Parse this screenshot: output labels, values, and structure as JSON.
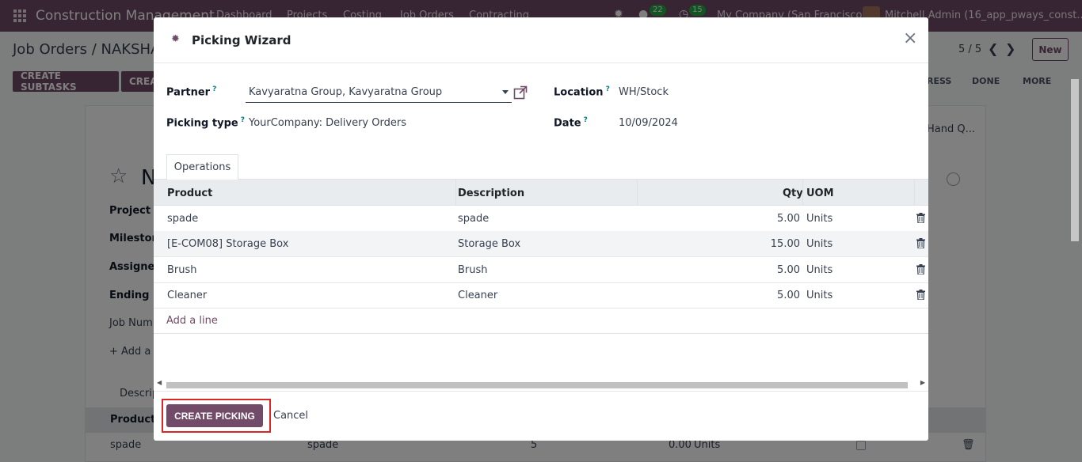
{
  "topnav": {
    "brand": "Construction Management",
    "menu": [
      "Dashboard",
      "Projects",
      "Costing",
      "Job Orders",
      "Contracting"
    ],
    "messages_count": "22",
    "activities_count": "15",
    "company": "My Company (San Francisco)",
    "user": "Mitchell Admin (16_app_pways_const..."
  },
  "control": {
    "breadcrumb": "Job Orders / NAKSHA",
    "pager": "5 / 5",
    "new_label": "New",
    "create_subtasks": "CREATE SUBTASKS",
    "create_partial": "CREA",
    "stages": [
      "RESS",
      "DONE",
      "MORE"
    ],
    "onhand_partial": "Hand Q..."
  },
  "background_form": {
    "title_partial": "N",
    "labels": [
      "Project",
      "Milestone",
      "Assignee",
      "Ending Da",
      "Job Numb"
    ],
    "add_partial": "+ Add a P",
    "desc_partial": "Descrip",
    "product_col": "Product",
    "row": {
      "product": "spade",
      "description": "spade",
      "qty1": "5",
      "qty2": "0.00",
      "uom": "Units"
    }
  },
  "modal": {
    "title": "Picking Wizard",
    "fields": {
      "partner_label": "Partner",
      "partner_value": "Kavyaratna Group, Kavyaratna Group",
      "picking_type_label": "Picking type",
      "picking_type_value": "YourCompany: Delivery Orders",
      "location_label": "Location",
      "location_value": "WH/Stock",
      "date_label": "Date",
      "date_value": "10/09/2024",
      "help_mark": "?"
    },
    "tab": "Operations",
    "columns": [
      "Product",
      "Description",
      "Qty",
      "UOM"
    ],
    "rows": [
      {
        "product": "spade",
        "description": "spade",
        "qty": "5.00",
        "uom": "Units"
      },
      {
        "product": "[E-COM08] Storage Box",
        "description": "Storage Box",
        "qty": "15.00",
        "uom": "Units"
      },
      {
        "product": "Brush",
        "description": "Brush",
        "qty": "5.00",
        "uom": "Units"
      },
      {
        "product": "Cleaner",
        "description": "Cleaner",
        "qty": "5.00",
        "uom": "Units"
      }
    ],
    "add_line": "Add a line",
    "create_picking": "CREATE PICKING",
    "cancel": "Cancel"
  },
  "colors": {
    "brand": "#714b67",
    "highlight": "#dc2626"
  }
}
